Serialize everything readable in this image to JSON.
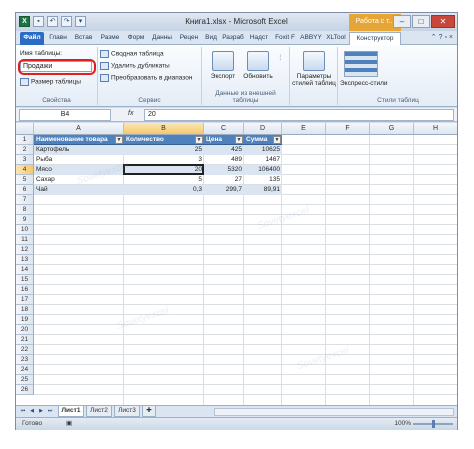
{
  "window": {
    "title": "Книга1.xlsx - Microsoft Excel",
    "contextual_title": "Работа с т...",
    "minimize": "–",
    "maximize": "□",
    "close": "✕"
  },
  "tabs": [
    {
      "label": "Файл"
    },
    {
      "label": "Главн"
    },
    {
      "label": "Встав"
    },
    {
      "label": "Разме"
    },
    {
      "label": "Форм"
    },
    {
      "label": "Данны"
    },
    {
      "label": "Рецен"
    },
    {
      "label": "Вид"
    },
    {
      "label": "Разраб"
    },
    {
      "label": "Надст"
    },
    {
      "label": "Foxit F"
    },
    {
      "label": "ABBYY"
    },
    {
      "label": "XLTool"
    },
    {
      "label": "Конструктор"
    }
  ],
  "ribbon": {
    "properties": {
      "table_name_label": "Имя таблицы:",
      "table_name_value": "Продажи",
      "resize_label": "Размер таблицы",
      "group_label": "Свойства"
    },
    "tools": {
      "pivot": "Сводная таблица",
      "remove_duplicates": "Удалить дубликаты",
      "convert_range": "Преобразовать в диапазон",
      "group_label": "Сервис"
    },
    "external": {
      "export": "Экспорт",
      "refresh": "Обновить",
      "group_label": "Данные из внешней таблицы"
    },
    "style_options": {
      "label": "Параметры стилей таблиц"
    },
    "styles": {
      "quick": "Экспресс-стили",
      "group_label": "Стили таблиц"
    }
  },
  "formula_bar": {
    "name_box": "B4",
    "fx": "fx",
    "value": "20"
  },
  "columns": [
    "A",
    "B",
    "C",
    "D",
    "E",
    "F",
    "G",
    "H",
    "I"
  ],
  "rows": [
    "1",
    "2",
    "3",
    "4",
    "5",
    "6",
    "7",
    "8",
    "9",
    "10",
    "11",
    "12",
    "13",
    "14",
    "15",
    "16",
    "17",
    "18",
    "19",
    "20",
    "21",
    "22",
    "23",
    "24",
    "25",
    "26"
  ],
  "table": {
    "headers": [
      "Наименование товара",
      "Количество",
      "Цена",
      "Сумма"
    ],
    "rows": [
      [
        "Картофель",
        "25",
        "425",
        "10625"
      ],
      [
        "Рыба",
        "3",
        "489",
        "1467"
      ],
      [
        "Мясо",
        "20",
        "5320",
        "106400"
      ],
      [
        "Сахар",
        "5",
        "27",
        "135"
      ],
      [
        "Чай",
        "0,3",
        "299,7",
        "89,91"
      ]
    ]
  },
  "sheets": [
    "Лист1",
    "Лист2",
    "Лист3"
  ],
  "status": {
    "ready": "Готово",
    "zoom": "100%"
  },
  "colors": {
    "table_header": "#4f81bd",
    "table_band": "#dbe5f1",
    "highlight": "#e02020",
    "file_tab": "#2a6cc4"
  }
}
